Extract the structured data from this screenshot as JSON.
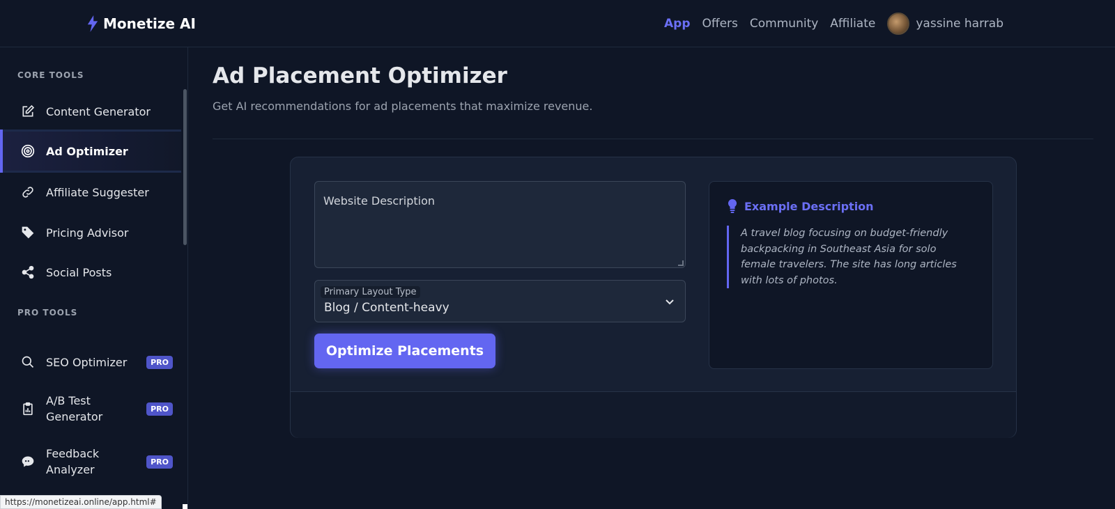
{
  "brand": {
    "name": "Monetize AI",
    "icon": "bolt-icon",
    "accent": "#6366f1"
  },
  "nav": {
    "items": [
      {
        "label": "App",
        "active": true
      },
      {
        "label": "Offers",
        "active": false
      },
      {
        "label": "Community",
        "active": false
      },
      {
        "label": "Affiliate",
        "active": false
      }
    ],
    "user": {
      "name": "yassine harrab"
    }
  },
  "sidebar": {
    "core_title": "CORE TOOLS",
    "core_items": [
      {
        "label": "Content Generator",
        "icon": "edit-icon"
      },
      {
        "label": "Ad Optimizer",
        "icon": "target-icon",
        "active": true
      },
      {
        "label": "Affiliate Suggester",
        "icon": "link-icon"
      },
      {
        "label": "Pricing Advisor",
        "icon": "tag-icon"
      },
      {
        "label": "Social Posts",
        "icon": "share-icon"
      }
    ],
    "pro_title": "PRO TOOLS",
    "pro_items": [
      {
        "label": "SEO Optimizer",
        "icon": "search-icon",
        "badge": "PRO"
      },
      {
        "label": "A/B Test Generator",
        "label_line1": "A/B Test",
        "label_line2": "Generator",
        "icon": "clipboard-chart-icon",
        "badge": "PRO"
      },
      {
        "label": "Feedback Analyzer",
        "label_line1": "Feedback",
        "label_line2": "Analyzer",
        "icon": "chat-bubble-icon",
        "badge": "PRO"
      }
    ]
  },
  "main": {
    "title": "Ad Placement Optimizer",
    "subtitle": "Get AI recommendations for ad placements that maximize revenue.",
    "form": {
      "description_placeholder": "Website Description",
      "layout_label": "Primary Layout Type",
      "layout_value": "Blog / Content-heavy",
      "submit_label": "Optimize Placements"
    },
    "example": {
      "title": "Example Description",
      "icon": "lightbulb-icon",
      "text": "A travel blog focusing on budget-friendly backpacking in Southeast Asia for solo female travelers. The site has long articles with lots of photos."
    }
  },
  "status_bar": {
    "url": "https://monetizeai.online/app.html#"
  }
}
